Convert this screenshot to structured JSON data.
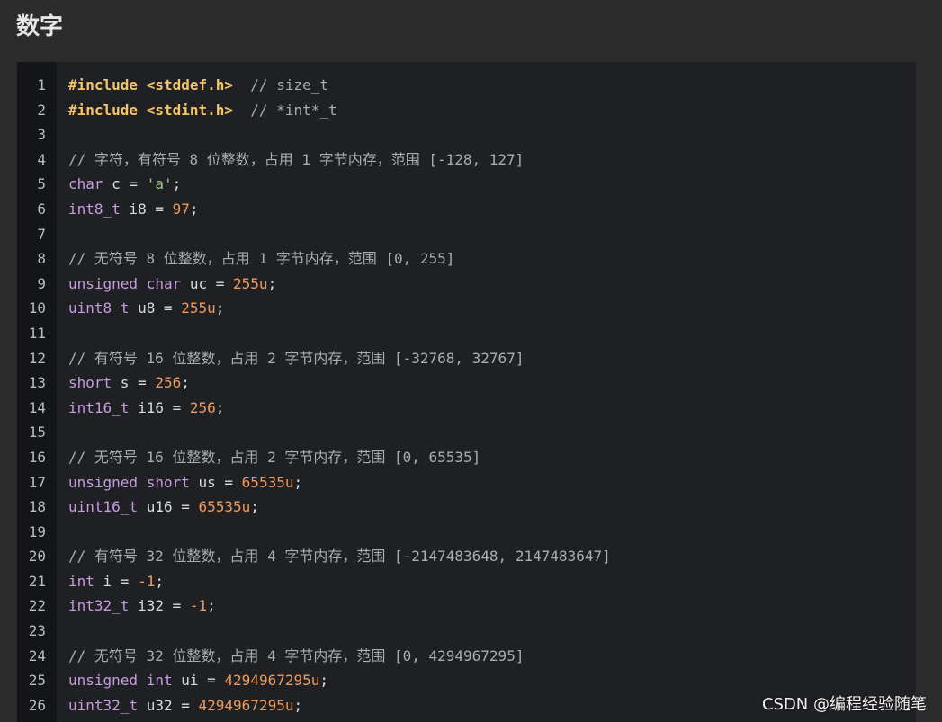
{
  "page": {
    "heading": "数字",
    "watermark": "CSDN @编程经验随笔"
  },
  "colors": {
    "background": "#2b2b2b",
    "code_background": "#1f2023",
    "gutter_background": "#141517",
    "preprocessor": "#f3c56a",
    "comment": "#a9acb1",
    "keyword": "#c79be0",
    "string": "#9ccc7a",
    "number": "#f19a5a",
    "plain": "#d8dbe0"
  },
  "code": {
    "language": "c",
    "lines": [
      {
        "n": "1",
        "tokens": [
          {
            "t": "pre",
            "v": "#include <stddef.h>"
          },
          {
            "t": "plain",
            "v": "  "
          },
          {
            "t": "cmt",
            "v": "// size_t"
          }
        ]
      },
      {
        "n": "2",
        "tokens": [
          {
            "t": "pre",
            "v": "#include <stdint.h>"
          },
          {
            "t": "plain",
            "v": "  "
          },
          {
            "t": "cmt",
            "v": "// *int*_t"
          }
        ]
      },
      {
        "n": "3",
        "tokens": []
      },
      {
        "n": "4",
        "tokens": [
          {
            "t": "cmt",
            "v": "// 字符，有符号 8 位整数，占用 1 字节内存，范围 [-128, 127]"
          }
        ]
      },
      {
        "n": "5",
        "tokens": [
          {
            "t": "kw",
            "v": "char"
          },
          {
            "t": "plain",
            "v": " c = "
          },
          {
            "t": "str",
            "v": "'a'"
          },
          {
            "t": "plain",
            "v": ";"
          }
        ]
      },
      {
        "n": "6",
        "tokens": [
          {
            "t": "kw",
            "v": "int8_t"
          },
          {
            "t": "plain",
            "v": " i8 = "
          },
          {
            "t": "num",
            "v": "97"
          },
          {
            "t": "plain",
            "v": ";"
          }
        ]
      },
      {
        "n": "7",
        "tokens": []
      },
      {
        "n": "8",
        "tokens": [
          {
            "t": "cmt",
            "v": "// 无符号 8 位整数，占用 1 字节内存，范围 [0, 255]"
          }
        ]
      },
      {
        "n": "9",
        "tokens": [
          {
            "t": "kw",
            "v": "unsigned"
          },
          {
            "t": "plain",
            "v": " "
          },
          {
            "t": "kw",
            "v": "char"
          },
          {
            "t": "plain",
            "v": " uc = "
          },
          {
            "t": "num",
            "v": "255u"
          },
          {
            "t": "plain",
            "v": ";"
          }
        ]
      },
      {
        "n": "10",
        "tokens": [
          {
            "t": "kw",
            "v": "uint8_t"
          },
          {
            "t": "plain",
            "v": " u8 = "
          },
          {
            "t": "num",
            "v": "255u"
          },
          {
            "t": "plain",
            "v": ";"
          }
        ]
      },
      {
        "n": "11",
        "tokens": []
      },
      {
        "n": "12",
        "tokens": [
          {
            "t": "cmt",
            "v": "// 有符号 16 位整数，占用 2 字节内存，范围 [-32768, 32767]"
          }
        ]
      },
      {
        "n": "13",
        "tokens": [
          {
            "t": "kw",
            "v": "short"
          },
          {
            "t": "plain",
            "v": " s = "
          },
          {
            "t": "num",
            "v": "256"
          },
          {
            "t": "plain",
            "v": ";"
          }
        ]
      },
      {
        "n": "14",
        "tokens": [
          {
            "t": "kw",
            "v": "int16_t"
          },
          {
            "t": "plain",
            "v": " i16 = "
          },
          {
            "t": "num",
            "v": "256"
          },
          {
            "t": "plain",
            "v": ";"
          }
        ]
      },
      {
        "n": "15",
        "tokens": []
      },
      {
        "n": "16",
        "tokens": [
          {
            "t": "cmt",
            "v": "// 无符号 16 位整数，占用 2 字节内存，范围 [0, 65535]"
          }
        ]
      },
      {
        "n": "17",
        "tokens": [
          {
            "t": "kw",
            "v": "unsigned"
          },
          {
            "t": "plain",
            "v": " "
          },
          {
            "t": "kw",
            "v": "short"
          },
          {
            "t": "plain",
            "v": " us = "
          },
          {
            "t": "num",
            "v": "65535u"
          },
          {
            "t": "plain",
            "v": ";"
          }
        ]
      },
      {
        "n": "18",
        "tokens": [
          {
            "t": "kw",
            "v": "uint16_t"
          },
          {
            "t": "plain",
            "v": " u16 = "
          },
          {
            "t": "num",
            "v": "65535u"
          },
          {
            "t": "plain",
            "v": ";"
          }
        ]
      },
      {
        "n": "19",
        "tokens": []
      },
      {
        "n": "20",
        "tokens": [
          {
            "t": "cmt",
            "v": "// 有符号 32 位整数，占用 4 字节内存，范围 [-2147483648, 2147483647]"
          }
        ]
      },
      {
        "n": "21",
        "tokens": [
          {
            "t": "kw",
            "v": "int"
          },
          {
            "t": "plain",
            "v": " i = "
          },
          {
            "t": "num",
            "v": "-1"
          },
          {
            "t": "plain",
            "v": ";"
          }
        ]
      },
      {
        "n": "22",
        "tokens": [
          {
            "t": "kw",
            "v": "int32_t"
          },
          {
            "t": "plain",
            "v": " i32 = "
          },
          {
            "t": "num",
            "v": "-1"
          },
          {
            "t": "plain",
            "v": ";"
          }
        ]
      },
      {
        "n": "23",
        "tokens": []
      },
      {
        "n": "24",
        "tokens": [
          {
            "t": "cmt",
            "v": "// 无符号 32 位整数，占用 4 字节内存，范围 [0, 4294967295]"
          }
        ]
      },
      {
        "n": "25",
        "tokens": [
          {
            "t": "kw",
            "v": "unsigned"
          },
          {
            "t": "plain",
            "v": " "
          },
          {
            "t": "kw",
            "v": "int"
          },
          {
            "t": "plain",
            "v": " ui = "
          },
          {
            "t": "num",
            "v": "4294967295u"
          },
          {
            "t": "plain",
            "v": ";"
          }
        ]
      },
      {
        "n": "26",
        "tokens": [
          {
            "t": "kw",
            "v": "uint32_t"
          },
          {
            "t": "plain",
            "v": " u32 = "
          },
          {
            "t": "num",
            "v": "4294967295u"
          },
          {
            "t": "plain",
            "v": ";"
          }
        ]
      }
    ]
  }
}
